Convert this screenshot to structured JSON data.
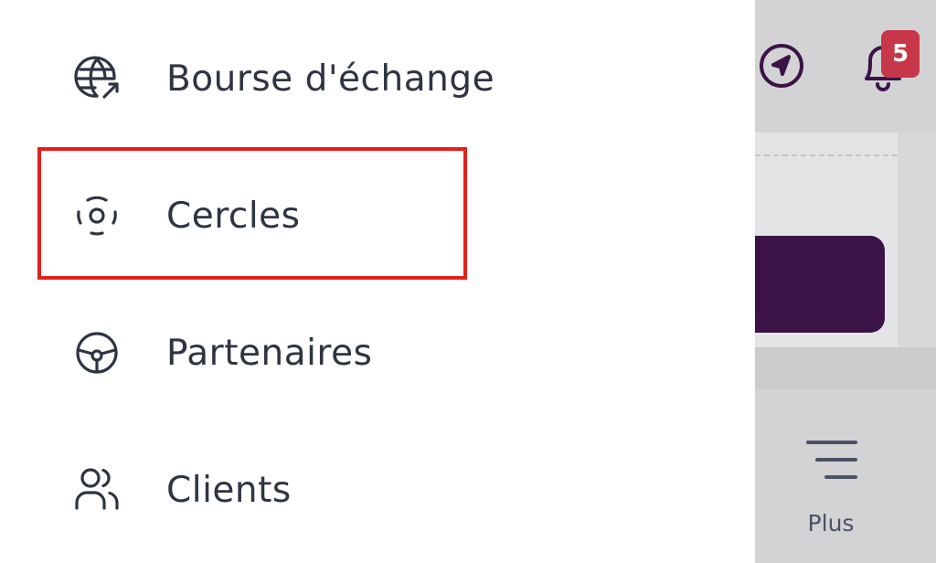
{
  "drawer": {
    "items": [
      {
        "label": "Bourse d'échange",
        "icon": "globe-arrow-icon"
      },
      {
        "label": "Cercles",
        "icon": "circles-icon"
      },
      {
        "label": "Partenaires",
        "icon": "steering-wheel-icon"
      },
      {
        "label": "Clients",
        "icon": "users-icon"
      }
    ],
    "highlighted_item": "Cercles"
  },
  "header": {
    "notification_count": "5",
    "navigation_icon": "navigation-arrow-icon",
    "bell_icon": "bell-icon"
  },
  "bottom_nav": {
    "more_label": "Plus",
    "more_icon": "menu-lines-icon"
  },
  "colors": {
    "accent": "#3b1346",
    "badge": "#c8364a",
    "highlight_border": "#e1211b",
    "text": "#2f3441",
    "overlay": "#d3d3d5"
  }
}
